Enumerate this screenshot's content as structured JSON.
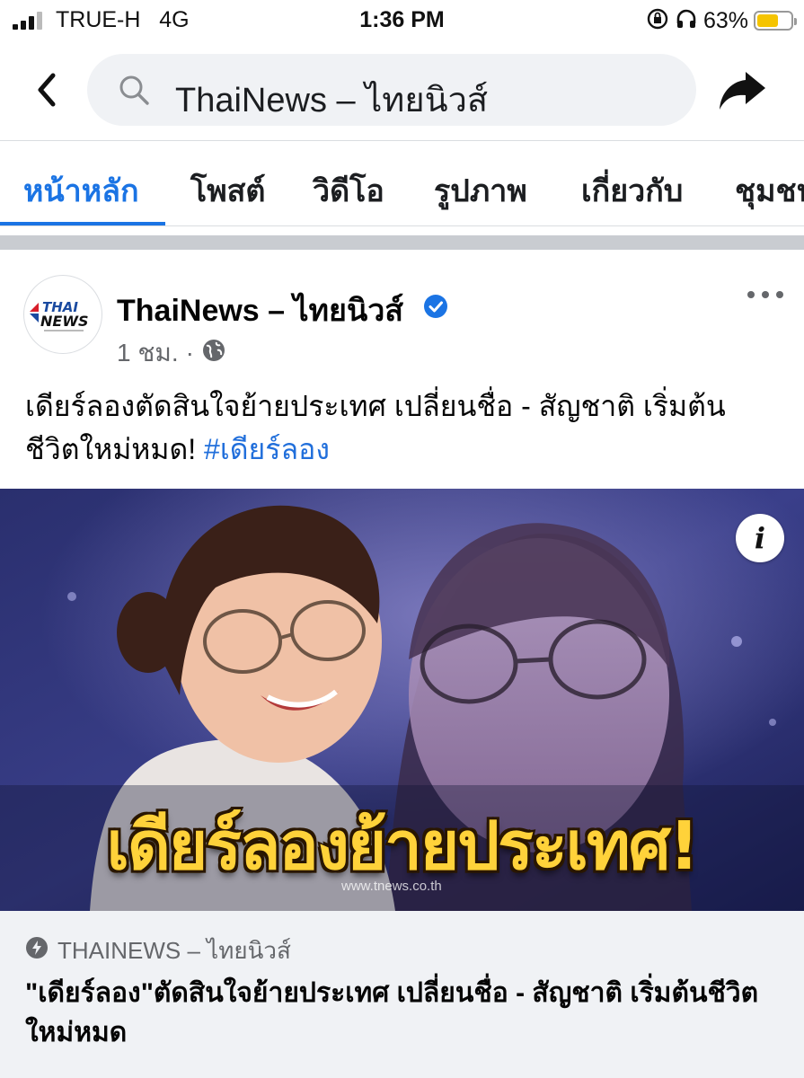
{
  "status_bar": {
    "carrier": "TRUE-H",
    "network": "4G",
    "time": "1:36 PM",
    "battery_percent": "63%",
    "battery_level": 0.63,
    "icons": [
      "signal-icon",
      "orientation-lock-icon",
      "headphones-icon",
      "battery-icon"
    ]
  },
  "header": {
    "search_text": "ThaiNews – ไทยนิวส์",
    "icons": [
      "back-chevron-icon",
      "search-icon",
      "share-icon"
    ]
  },
  "tabs": [
    {
      "label": "หน้าหลัก",
      "active": true
    },
    {
      "label": "โพสต์",
      "active": false
    },
    {
      "label": "วิดีโอ",
      "active": false
    },
    {
      "label": "รูปภาพ",
      "active": false
    },
    {
      "label": "เกี่ยวกับ",
      "active": false
    },
    {
      "label": "ชุมชน",
      "active": false
    }
  ],
  "post": {
    "page_name": "ThaiNews – ไทยนิวส์",
    "avatar_logo_top": "THAI",
    "avatar_logo_bottom": "NEWS",
    "time_ago": "1 ชม.",
    "separator": "·",
    "privacy_icon": "globe-icon",
    "text": "เดียร์ลองตัดสินใจย้ายประเทศ เปลี่ยนชื่อ - สัญชาติ เริ่มต้นชีวิตใหม่หมด!",
    "hashtag": "#เดียร์ลอง",
    "image": {
      "headline": "เดียร์ลองย้ายประเทศ!",
      "watermark": "www.tnews.co.th",
      "info_label": "i"
    },
    "link_preview": {
      "source": "THAINEWS – ไทยนิวส์",
      "title": "\"เดียร์ลอง\"ตัดสินใจย้ายประเทศ เปลี่ยนชื่อ - สัญชาติ เริ่มต้นชีวิตใหม่หมด"
    }
  },
  "colors": {
    "accent": "#1b74e4",
    "hashtag": "#216fdb",
    "secondary_text": "#65676b",
    "battery": "#f5c400",
    "headline": "#ffd23a"
  }
}
